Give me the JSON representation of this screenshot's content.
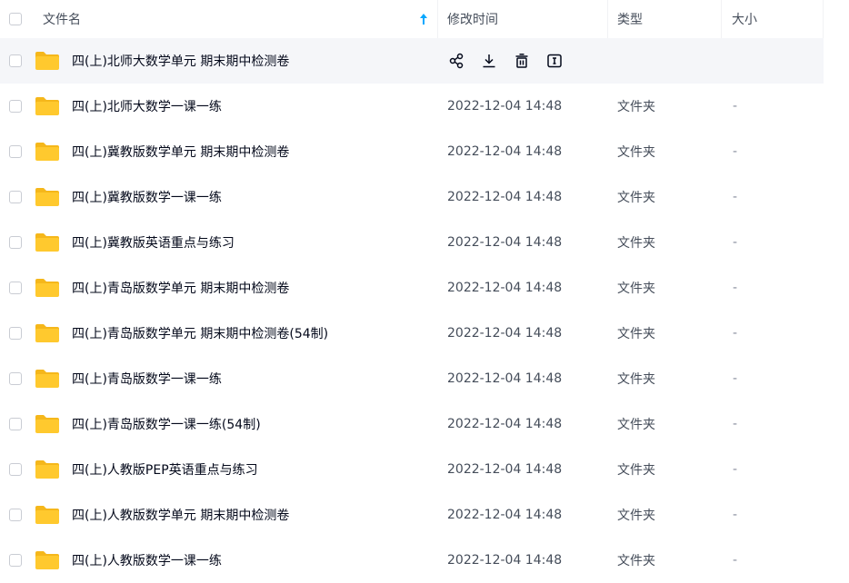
{
  "header": {
    "name_label": "文件名",
    "time_label": "修改时间",
    "type_label": "类型",
    "size_label": "大小"
  },
  "colors": {
    "folder": "#ffc92e",
    "folder_tab": "#f5b71b",
    "sort_arrow": "#06a7ff",
    "hover_row": "#f5f6f9"
  },
  "icons": {
    "share": "share-icon",
    "download": "download-icon",
    "delete": "trash-icon",
    "rename": "rename-icon"
  },
  "rows": [
    {
      "name": "四(上)北师大数学单元 期末期中检测卷",
      "time": "",
      "type": "",
      "size": "",
      "hovered": true
    },
    {
      "name": "四(上)北师大数学一课一练",
      "time": "2022-12-04 14:48",
      "type": "文件夹",
      "size": "-"
    },
    {
      "name": "四(上)冀教版数学单元 期末期中检测卷",
      "time": "2022-12-04 14:48",
      "type": "文件夹",
      "size": "-"
    },
    {
      "name": "四(上)冀教版数学一课一练",
      "time": "2022-12-04 14:48",
      "type": "文件夹",
      "size": "-"
    },
    {
      "name": "四(上)冀教版英语重点与练习",
      "time": "2022-12-04 14:48",
      "type": "文件夹",
      "size": "-"
    },
    {
      "name": "四(上)青岛版数学单元 期末期中检测卷",
      "time": "2022-12-04 14:48",
      "type": "文件夹",
      "size": "-"
    },
    {
      "name": "四(上)青岛版数学单元 期末期中检测卷(54制)",
      "time": "2022-12-04 14:48",
      "type": "文件夹",
      "size": "-"
    },
    {
      "name": "四(上)青岛版数学一课一练",
      "time": "2022-12-04 14:48",
      "type": "文件夹",
      "size": "-"
    },
    {
      "name": "四(上)青岛版数学一课一练(54制)",
      "time": "2022-12-04 14:48",
      "type": "文件夹",
      "size": "-"
    },
    {
      "name": "四(上)人教版PEP英语重点与练习",
      "time": "2022-12-04 14:48",
      "type": "文件夹",
      "size": "-"
    },
    {
      "name": "四(上)人教版数学单元 期末期中检测卷",
      "time": "2022-12-04 14:48",
      "type": "文件夹",
      "size": "-"
    },
    {
      "name": "四(上)人教版数学一课一练",
      "time": "2022-12-04 14:48",
      "type": "文件夹",
      "size": "-"
    }
  ]
}
